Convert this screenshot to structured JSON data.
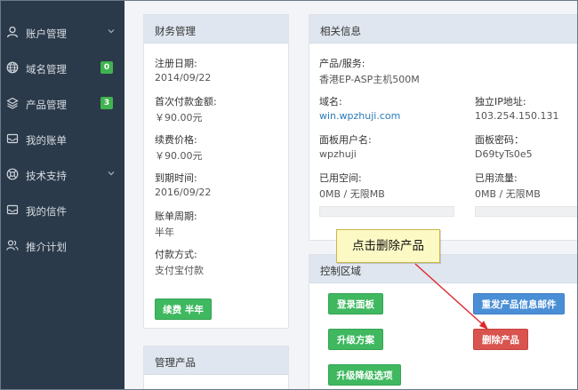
{
  "sidebar": {
    "items": [
      {
        "label": "账户管理",
        "icon": "user-icon",
        "expandable": true
      },
      {
        "label": "域名管理",
        "icon": "globe-icon",
        "badge": "0"
      },
      {
        "label": "产品管理",
        "icon": "layers-icon",
        "badge": "3"
      },
      {
        "label": "我的账单",
        "icon": "inbox-icon"
      },
      {
        "label": "技术支持",
        "icon": "lifebuoy-icon",
        "expandable": true
      },
      {
        "label": "我的信件",
        "icon": "mail-icon"
      },
      {
        "label": "推介计划",
        "icon": "users-icon"
      }
    ],
    "badge_color": "#3fb34f"
  },
  "finance": {
    "title": "财务管理",
    "reg_date_label": "注册日期:",
    "reg_date": "2014/09/22",
    "first_pay_label": "首次付款金额:",
    "first_pay": "￥90.00元",
    "renew_price_label": "续费价格:",
    "renew_price": "￥90.00元",
    "expire_label": "到期时间:",
    "expire": "2016/09/22",
    "cycle_label": "账单周期:",
    "cycle": "半年",
    "pay_method_label": "付款方式:",
    "pay_method": "支付宝付款",
    "renew_button": "续费 半年"
  },
  "manage": {
    "title": "管理产品"
  },
  "info": {
    "title": "相关信息",
    "product_label": "产品/服务:",
    "product": "香港EP-ASP主机500M",
    "domain_label": "域名:",
    "domain": "win.wpzhuji.com",
    "ip_label": "独立IP地址:",
    "ip": "103.254.150.131",
    "panel_user_label": "面板用户名:",
    "panel_user": "wpzhuji",
    "panel_pass_label": "面板密码：",
    "panel_pass": "D69tyTs0e5",
    "space_label": "已用空间:",
    "space": "0MB / 无限MB",
    "traffic_label": "已用流量:",
    "traffic": "0MB / 无限MB",
    "space_used_fraction": 0,
    "traffic_used_fraction": 0
  },
  "control": {
    "title": "控制区域",
    "login_panel": "登录面板",
    "resend_email": "重发产品信息邮件",
    "upgrade": "升级方案",
    "delete_product": "删除产品",
    "upgrade_options": "升级降级选项"
  },
  "annotation": {
    "callout_text": "点击删除产品",
    "arrow_color": "#e0262b"
  },
  "colors": {
    "sidebar_bg": "#2b3a4a",
    "panel_header": "#dfe6ef",
    "btn_green": "#3fb860",
    "btn_blue": "#4a8fd6",
    "btn_red": "#d9534f"
  }
}
